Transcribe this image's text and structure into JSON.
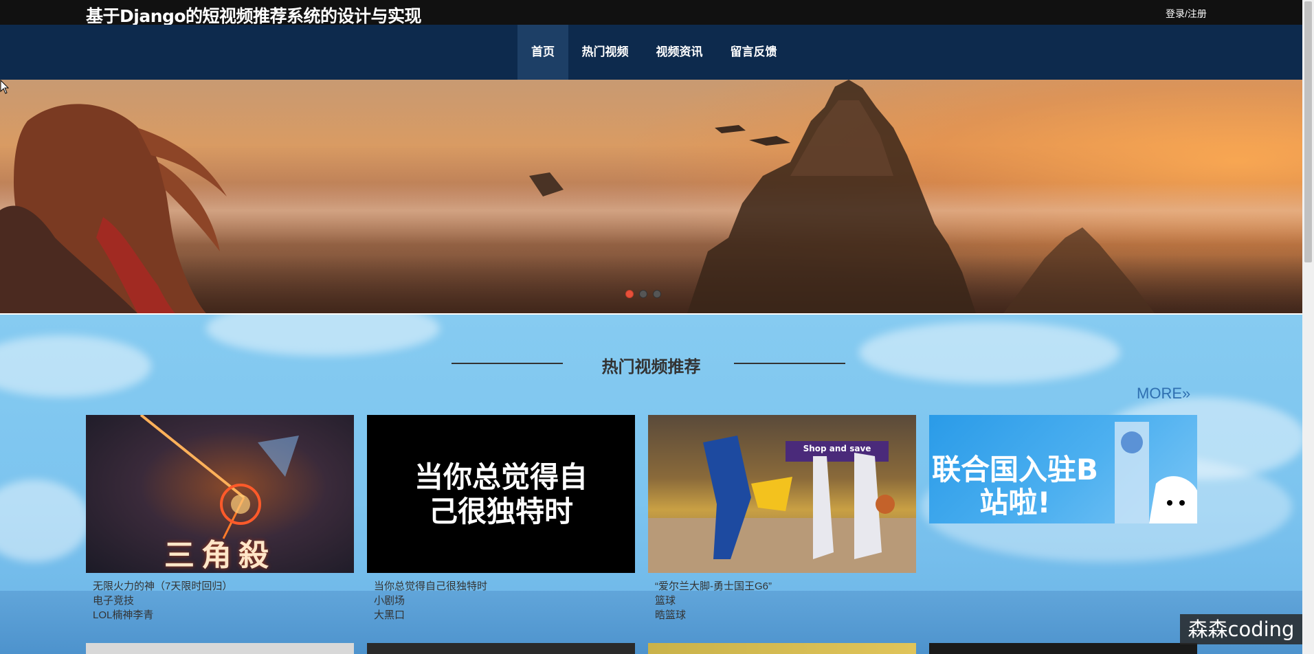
{
  "header": {
    "site_title": "基于Django的短视频推荐系统的设计与实现",
    "login_label": "登录/注册"
  },
  "nav": {
    "items": [
      {
        "label": "首页",
        "active": true
      },
      {
        "label": "热门视频",
        "active": false
      },
      {
        "label": "视频资讯",
        "active": false
      },
      {
        "label": "留言反馈",
        "active": false
      }
    ]
  },
  "banner": {
    "slides": 3,
    "active_slide": 1
  },
  "hot": {
    "title": "热门视频推荐",
    "more_label": "MORE»",
    "videos": [
      {
        "title": "无限火力的神（7天限时回归）",
        "category": "电子竞技",
        "author": "LOL楠神李青",
        "thumb_text": "三角殺"
      },
      {
        "title": "当你总觉得自己很独特时",
        "category": "小剧场",
        "author": "大黑口",
        "thumb_text": "当你总觉得自己很独特时"
      },
      {
        "title": "“爱尔兰大脚-勇士国王G6”",
        "category": "篮球",
        "author": "晧篮球",
        "thumb_text": "Shop and save"
      },
      {
        "title": "",
        "category": "",
        "author": "",
        "thumb_text": "联合国入驻B站啦!"
      }
    ]
  },
  "watermark": "森森coding",
  "colors": {
    "topbar": "#111111",
    "navbar": "#0d2a4d",
    "nav_active": "#1d3f66",
    "section_bg": "#86cbf1",
    "more_link": "#2f6fb0",
    "dot_active": "#e8503a"
  }
}
